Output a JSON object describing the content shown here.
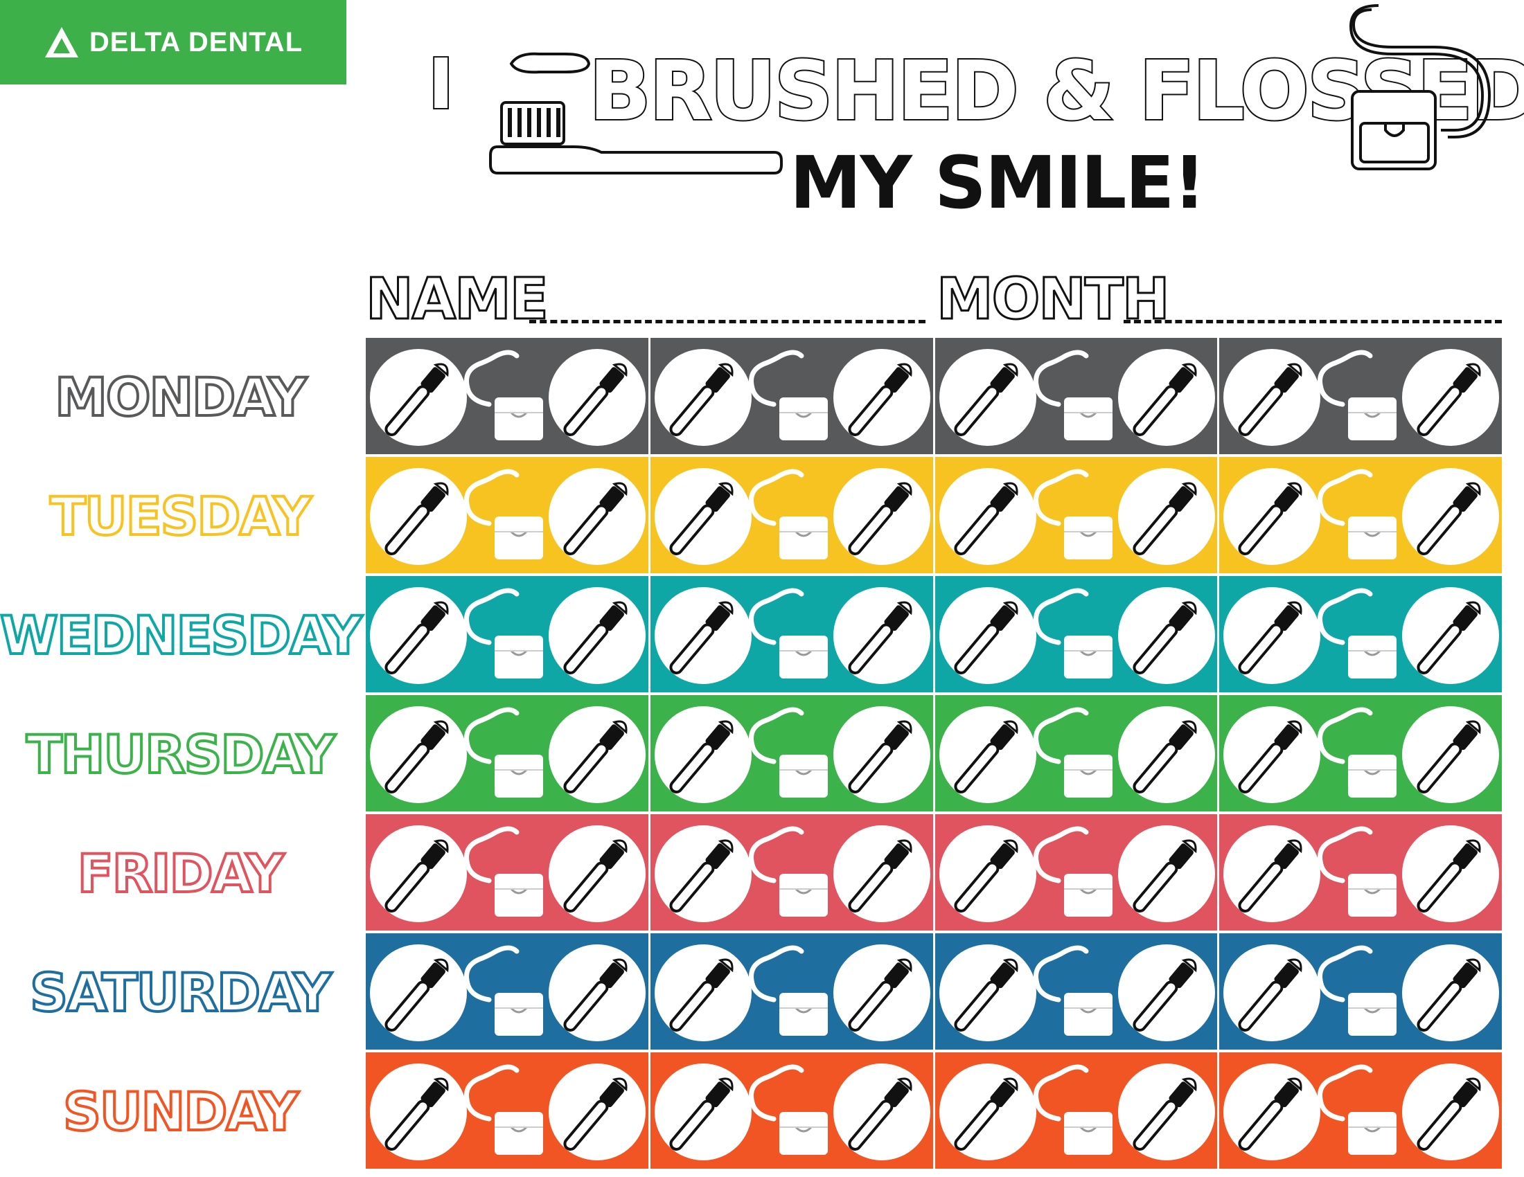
{
  "brand": {
    "name": "DELTA DENTAL",
    "color": "#3eb049",
    "icon": "delta-triangle-icon"
  },
  "title": {
    "line1_part1": "I",
    "line1_part2": "BRUSHED & FLOSSED",
    "line2": "MY SMILE!"
  },
  "fields": {
    "name_label": "NAME",
    "month_label": "MONTH"
  },
  "days": [
    {
      "label": "MONDAY",
      "color": "#58595b"
    },
    {
      "label": "TUESDAY",
      "color": "#f7c321"
    },
    {
      "label": "WEDNESDAY",
      "color": "#0fa7a5"
    },
    {
      "label": "THURSDAY",
      "color": "#3bb24a"
    },
    {
      "label": "FRIDAY",
      "color": "#e0545f"
    },
    {
      "label": "SATURDAY",
      "color": "#1e6f9f"
    },
    {
      "label": "SUNDAY",
      "color": "#f05523"
    }
  ],
  "weeks_per_row": 4,
  "cell_icons": [
    "toothbrush-morning-icon",
    "floss-icon",
    "toothbrush-evening-icon"
  ]
}
